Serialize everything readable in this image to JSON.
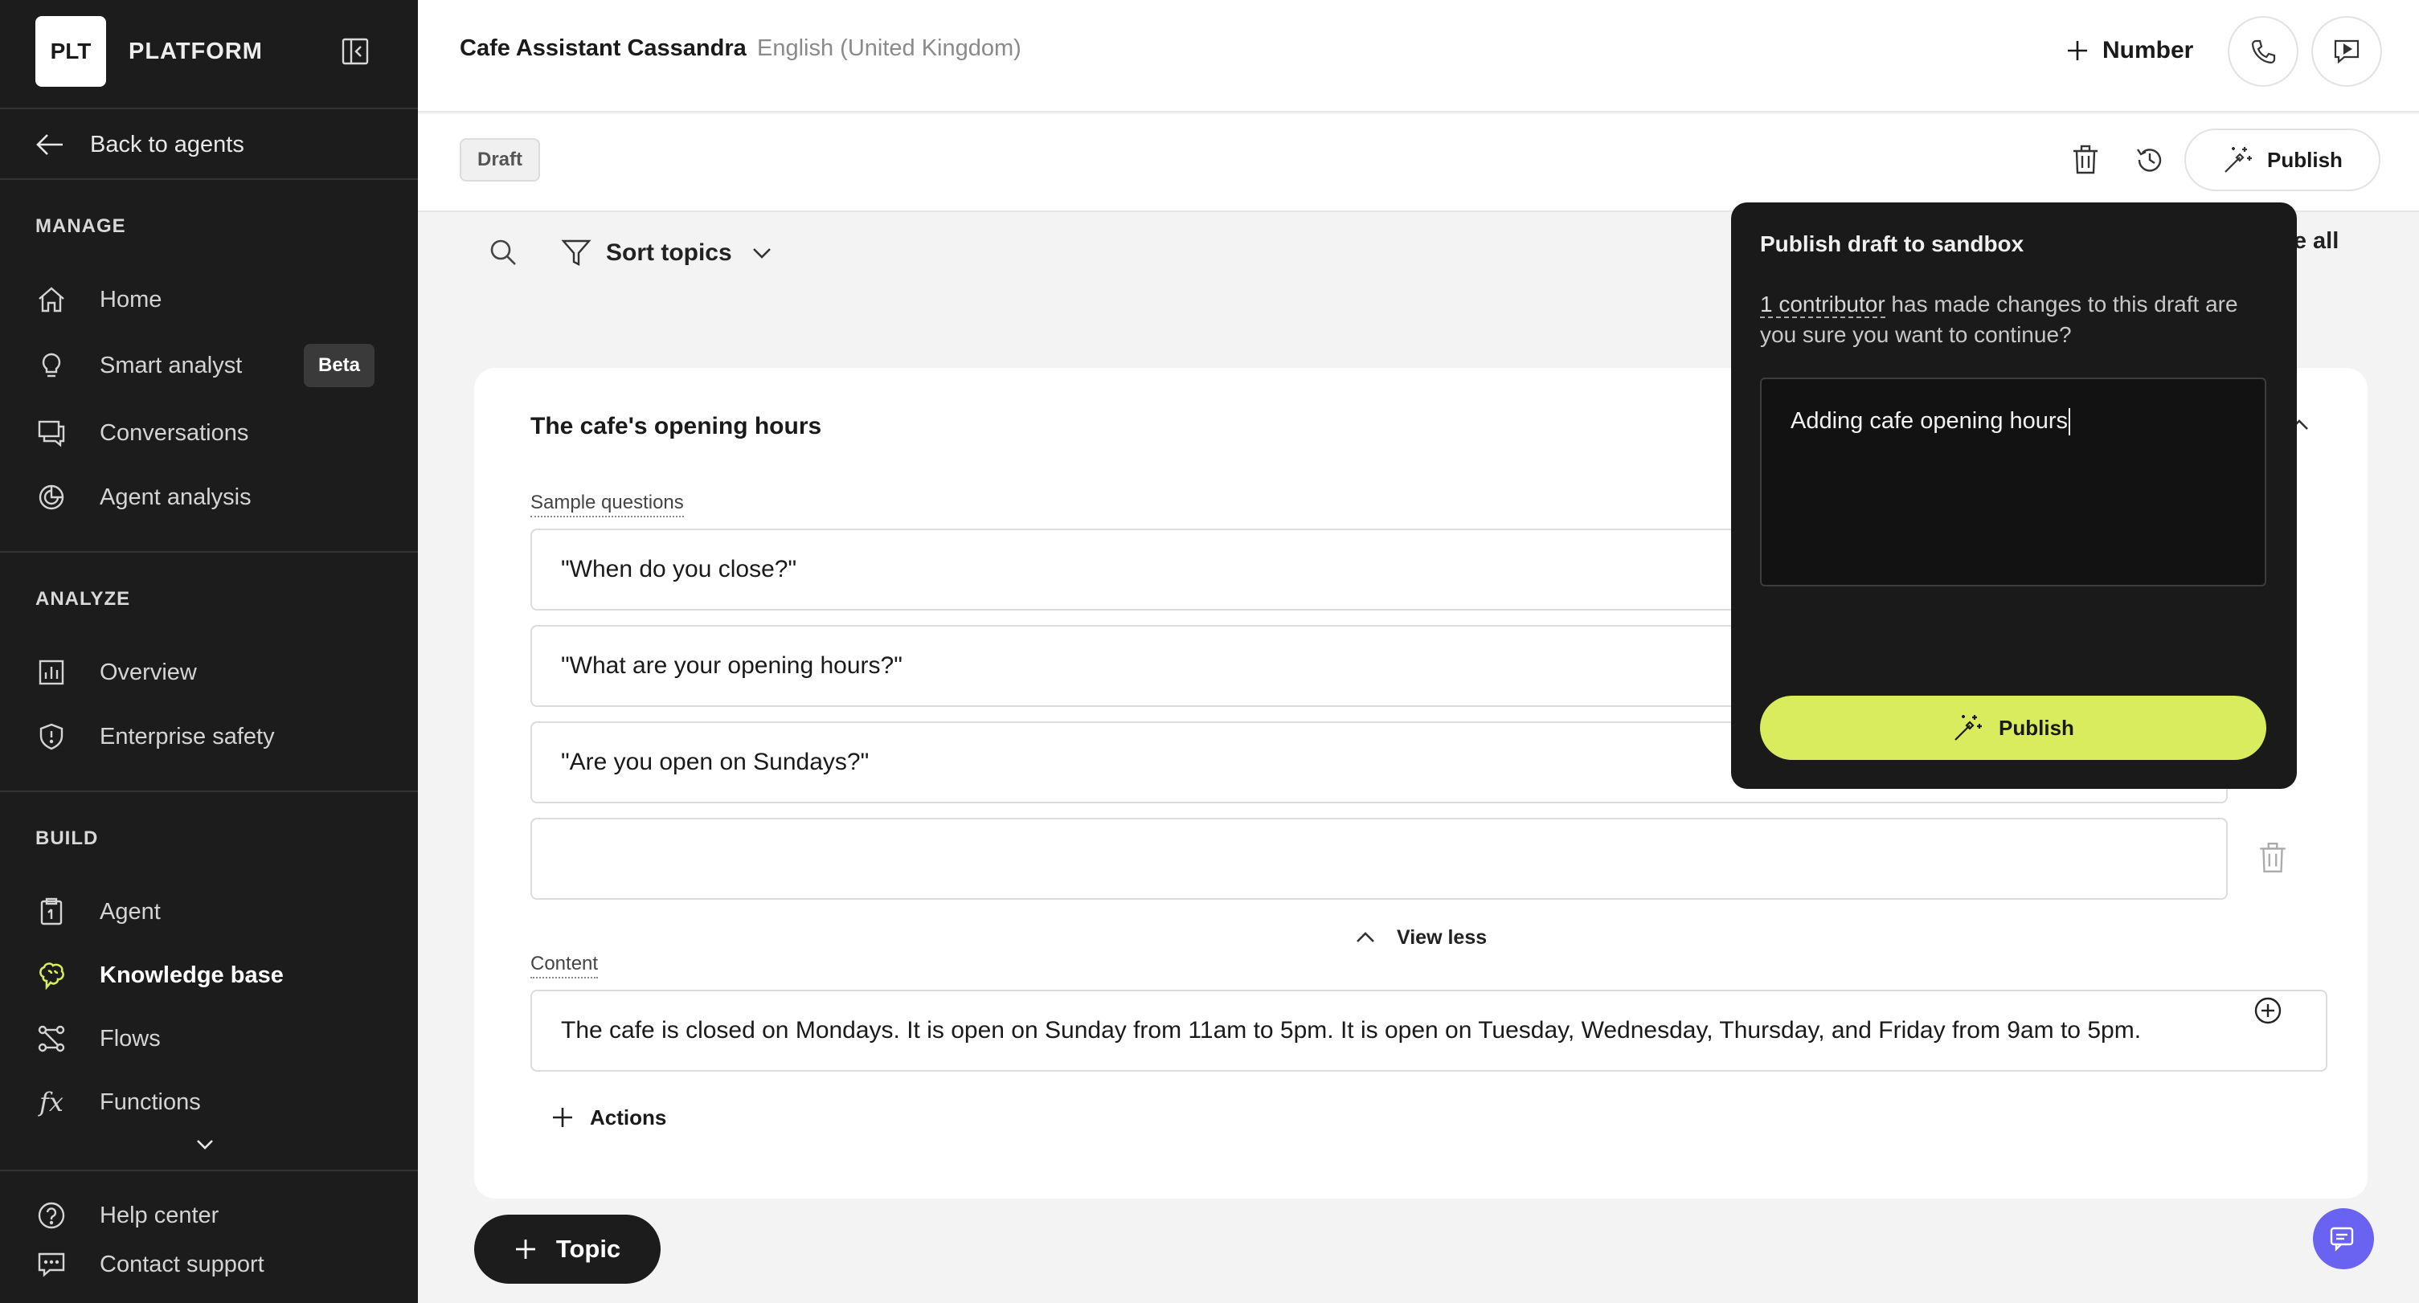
{
  "sidebar": {
    "logo_text": "PLT",
    "brand": "PLATFORM",
    "back_label": "Back to agents",
    "sections": {
      "manage": "MANAGE",
      "analyze": "ANALYZE",
      "build": "BUILD"
    },
    "manage_items": [
      {
        "label": "Home",
        "icon": "home-icon"
      },
      {
        "label": "Smart analyst",
        "icon": "lightbulb-icon",
        "badge": "Beta"
      },
      {
        "label": "Conversations",
        "icon": "conversations-icon"
      },
      {
        "label": "Agent analysis",
        "icon": "pie-chart-icon"
      }
    ],
    "analyze_items": [
      {
        "label": "Overview",
        "icon": "bar-chart-icon"
      },
      {
        "label": "Enterprise safety",
        "icon": "shield-icon"
      }
    ],
    "build_items": [
      {
        "label": "Agent",
        "icon": "clipboard-icon"
      },
      {
        "label": "Knowledge base",
        "icon": "brain-icon",
        "active": true
      },
      {
        "label": "Flows",
        "icon": "flows-icon"
      },
      {
        "label": "Functions",
        "icon": "function-icon"
      }
    ],
    "footer_items": [
      {
        "label": "Help center",
        "icon": "help-icon"
      },
      {
        "label": "Contact support",
        "icon": "support-chat-icon"
      }
    ],
    "accent_color": "#d8ec5e"
  },
  "header": {
    "agent_name": "Cafe Assistant Cassandra",
    "language": "English (United Kingdom)",
    "number_label": "Number"
  },
  "subbar": {
    "status_badge": "Draft",
    "publish_label": "Publish"
  },
  "toolbar": {
    "sort_label": "Sort topics",
    "collapse_all_label": "pse all"
  },
  "topic": {
    "title": "The cafe's opening hours",
    "sample_questions_label": "Sample questions",
    "questions": [
      "\"When do you close?\"",
      "\"What are your opening hours?\"",
      "\"Are you open on Sundays?\"",
      ""
    ],
    "view_less_label": "View less",
    "content_label": "Content",
    "content_text": "The cafe is closed on Mondays. It is open on Sunday from 11am to 5pm. It is open on Tuesday, Wednesday, Thursday, and Friday from 9am to 5pm.",
    "actions_label": "Actions"
  },
  "add_topic_label": "Topic",
  "popover": {
    "title": "Publish draft to sandbox",
    "contributor_link": "1 contributor",
    "message_rest": " has made changes to this draft are you sure you want to continue?",
    "textarea_value": "Adding cafe opening hours",
    "publish_label": "Publish",
    "button_color": "#d8ec5e"
  },
  "chat_fab_color": "#6a62f0"
}
